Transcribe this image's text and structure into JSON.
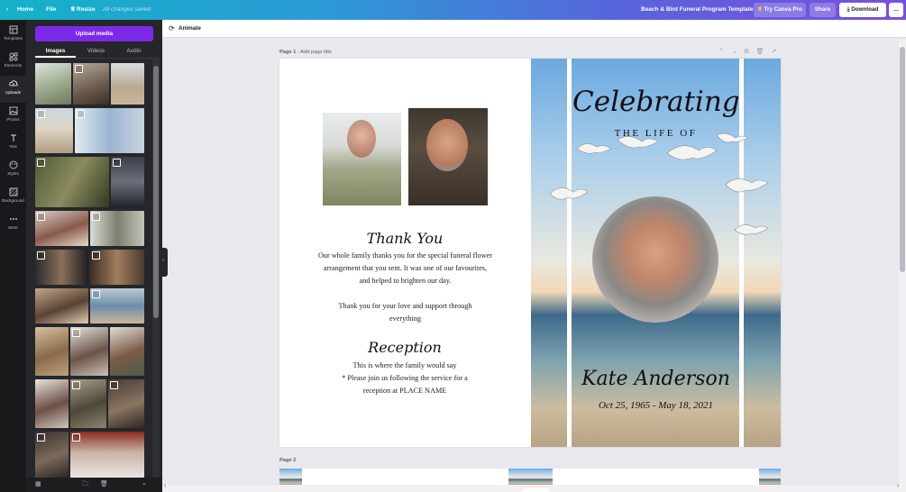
{
  "topbar": {
    "home": "Home",
    "file": "File",
    "resize": "Resize",
    "save_status": "All changes saved",
    "doc_title": "Beach & Bird Funeral Program Template",
    "try_pro": "Try Canva Pro",
    "share": "Share",
    "download": "Download",
    "more": "..."
  },
  "rail": [
    {
      "label": "Templates",
      "icon": "templates-icon"
    },
    {
      "label": "Elements",
      "icon": "elements-icon"
    },
    {
      "label": "Uploads",
      "icon": "upload-cloud-icon"
    },
    {
      "label": "Photos",
      "icon": "photos-icon"
    },
    {
      "label": "Text",
      "icon": "text-icon"
    },
    {
      "label": "Styles",
      "icon": "styles-icon"
    },
    {
      "label": "Background",
      "icon": "background-icon"
    },
    {
      "label": "More",
      "icon": "more-icon"
    }
  ],
  "panel": {
    "upload_btn": "Upload media",
    "tabs": [
      "Images",
      "Videos",
      "Audio"
    ]
  },
  "toolbar": {
    "animate": "Animate"
  },
  "page1": {
    "label": "Page 1",
    "add_title": "- Add page title",
    "thank_heading": "Thank You",
    "thank_body": "Our whole family thanks you for the special funeral flower arrangement that you sent. It was one of our favourites, and helped to brighten our day.",
    "thank_body2": "Thank you for your love and support through everything",
    "reception_heading": "Reception",
    "reception_line1": "This is where the family would say",
    "reception_line2": "* Please join us following the service for a",
    "reception_line3": "reception at PLACE NAME",
    "celebrating": "Celebrating",
    "life_of": "THE LIFE OF",
    "name": "Kate Anderson",
    "dates": "Oct 25, 1965 - May 18, 2021"
  },
  "page2": {
    "label": "Page 2"
  },
  "colors": {
    "accent": "#7d2ae8",
    "teal": "#14b2c8",
    "purple": "#7a4fe0"
  }
}
